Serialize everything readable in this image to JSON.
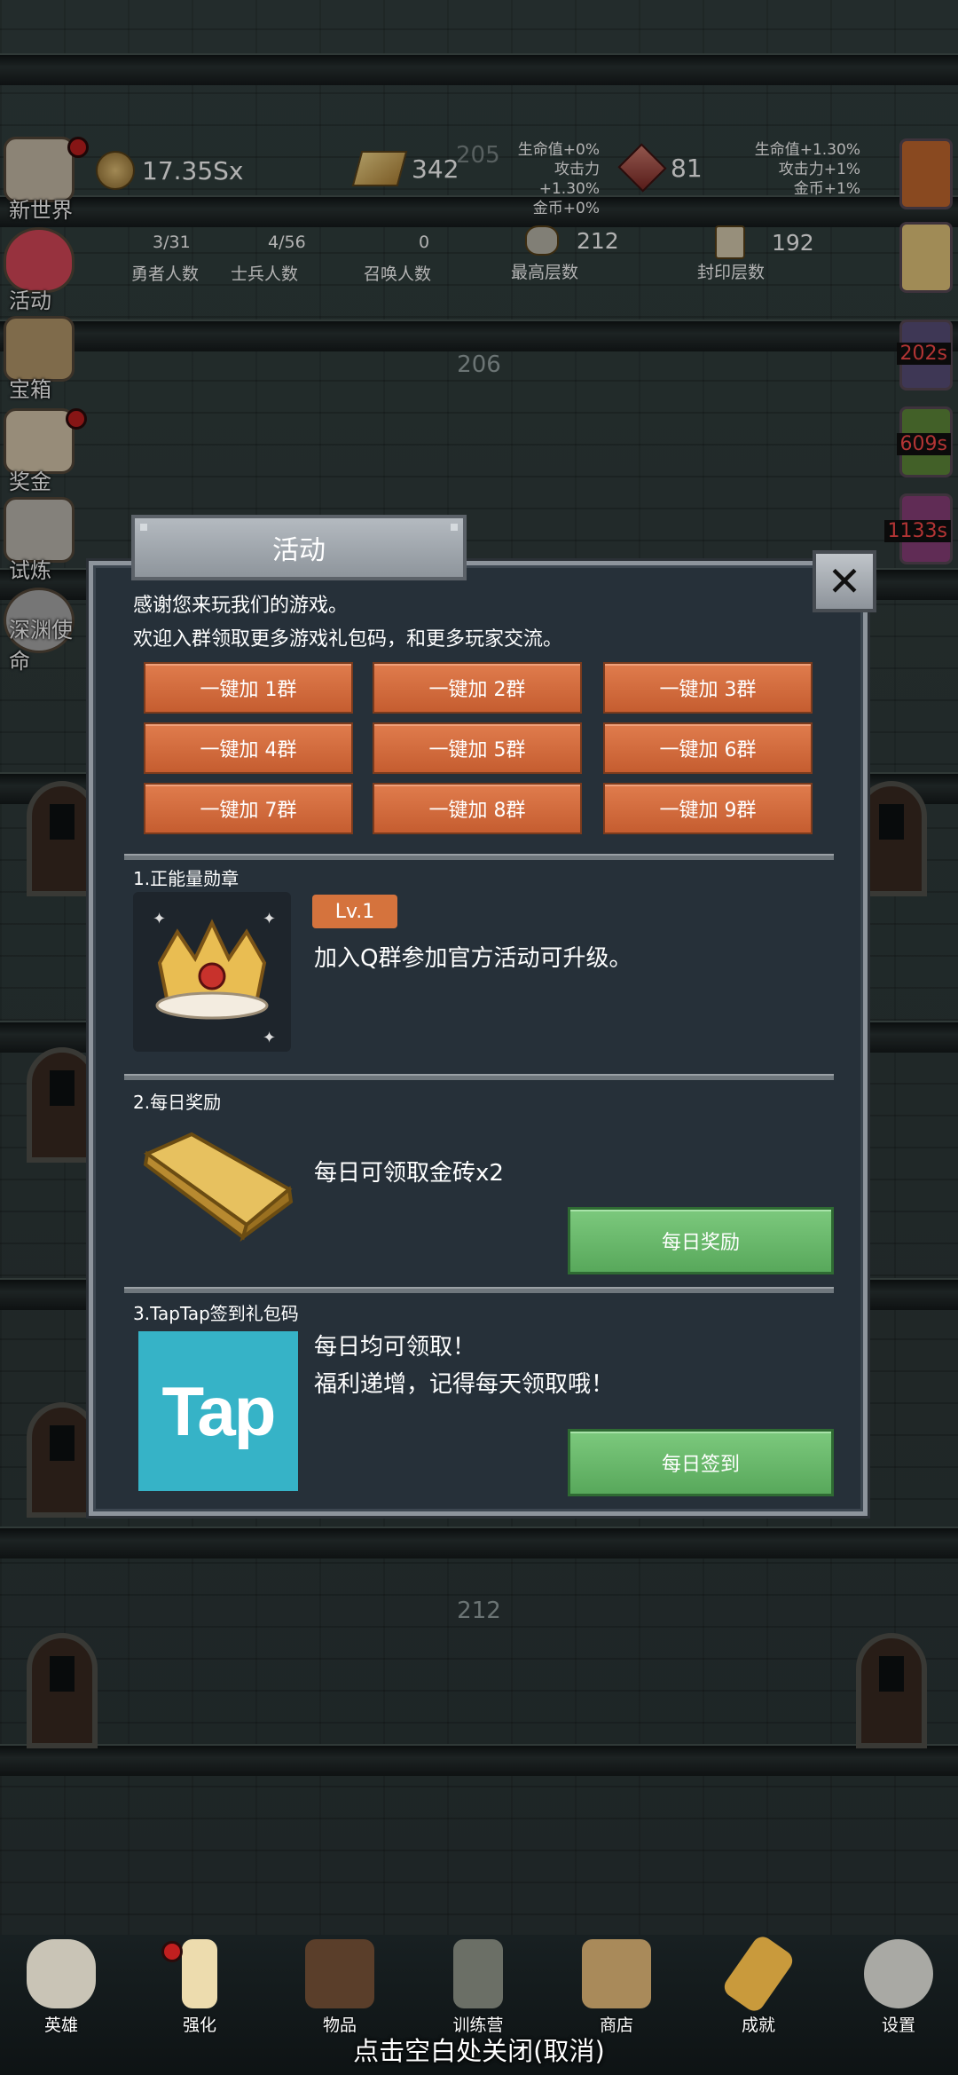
{
  "top_stats": {
    "gold": "17.35Sx",
    "bricks": "342",
    "gems": "81",
    "floor_top": "205",
    "bonus_left": [
      "生命值+0%",
      "攻击力+1.30%",
      "金币+0%"
    ],
    "bonus_right": [
      "生命值+1.30%",
      "攻击力+1%",
      "金币+1%"
    ]
  },
  "counters": {
    "hero_count": "3/31",
    "hero_label": "勇者人数",
    "soldier_count": "4/56",
    "soldier_label": "士兵人数",
    "summon_count": "0",
    "summon_label": "召唤人数",
    "max_floor": "212",
    "max_floor_label": "最高层数",
    "seal_floor": "192",
    "seal_floor_label": "封印层数"
  },
  "floors": [
    "206",
    "212"
  ],
  "side_menu": [
    "新世界",
    "活动",
    "宝箱",
    "奖金",
    "试炼",
    "深渊使命"
  ],
  "right_timers": [
    "202s",
    "609s",
    "1133s"
  ],
  "dialog": {
    "title": "活动",
    "close_icon": "close-x-icon",
    "intro_line1": "感谢您来玩我们的游戏。",
    "intro_line2": "欢迎入群领取更多游戏礼包码，和更多玩家交流。",
    "groups": [
      "一键加 1群",
      "一键加 2群",
      "一键加 3群",
      "一键加 4群",
      "一键加 5群",
      "一键加 6群",
      "一键加 7群",
      "一键加 8群",
      "一键加 9群"
    ],
    "section1": {
      "title": "1.正能量勋章",
      "level": "Lv.1",
      "desc": "加入Q群参加官方活动可升级。"
    },
    "section2": {
      "title": "2.每日奖励",
      "desc": "每日可领取金砖x2",
      "button": "每日奖励"
    },
    "section3": {
      "title": "3.TapTap签到礼包码",
      "logo": "Tap",
      "line1": "每日均可领取！",
      "line2": "福利递增，记得每天领取哦！",
      "button": "每日签到"
    }
  },
  "nav": [
    "英雄",
    "强化",
    "物品",
    "训练营",
    "商店",
    "成就",
    "设置"
  ],
  "close_hint": "点击空白处关闭(取消)",
  "colors": {
    "orange_button": "#d5703f",
    "green_button": "#6cbb6e",
    "dialog_bg": "#263039",
    "tap_blue": "#36b3c7"
  }
}
